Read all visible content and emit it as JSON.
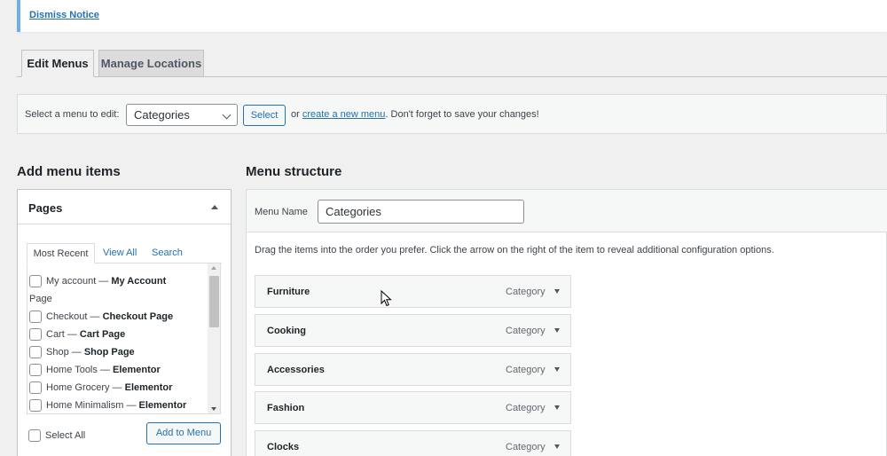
{
  "notice": {
    "dismiss": "Dismiss Notice"
  },
  "tabs": [
    {
      "label": "Edit Menus"
    },
    {
      "label": "Manage Locations"
    }
  ],
  "select_menu": {
    "label": "Select a menu to edit:",
    "value": "Categories",
    "button": "Select",
    "help_prefix": "or",
    "help_link": "create a new menu",
    "help_suffix": ". Don't forget to save your changes!"
  },
  "add_items": {
    "heading": "Add menu items",
    "panel_title": "Pages",
    "tabs": [
      "Most Recent",
      "View All",
      "Search"
    ],
    "items": [
      {
        "text": "My account — ",
        "bold": "My Account"
      },
      {
        "text": "Page",
        "bold": ""
      },
      {
        "text": "Checkout — ",
        "bold": "Checkout Page"
      },
      {
        "text": "Cart — ",
        "bold": "Cart Page"
      },
      {
        "text": "Shop — ",
        "bold": "Shop Page"
      },
      {
        "text": "Home Tools — ",
        "bold": "Elementor"
      },
      {
        "text": "Home Grocery — ",
        "bold": "Elementor"
      },
      {
        "text": "Home Minimalism — ",
        "bold": "Elementor"
      }
    ],
    "select_all": "Select All",
    "add_button": "Add to Menu"
  },
  "structure": {
    "heading": "Menu structure",
    "name_label": "Menu Name",
    "name_value": "Categories",
    "help": "Drag the items into the order you prefer. Click the arrow on the right of the item to reveal additional configuration options.",
    "items": [
      {
        "title": "Furniture",
        "type": "Category"
      },
      {
        "title": "Cooking",
        "type": "Category"
      },
      {
        "title": "Accessories",
        "type": "Category"
      },
      {
        "title": "Fashion",
        "type": "Category"
      },
      {
        "title": "Clocks",
        "type": "Category"
      }
    ]
  },
  "colors": {
    "accent": "#2271b1",
    "notice_border": "#72aee6"
  }
}
